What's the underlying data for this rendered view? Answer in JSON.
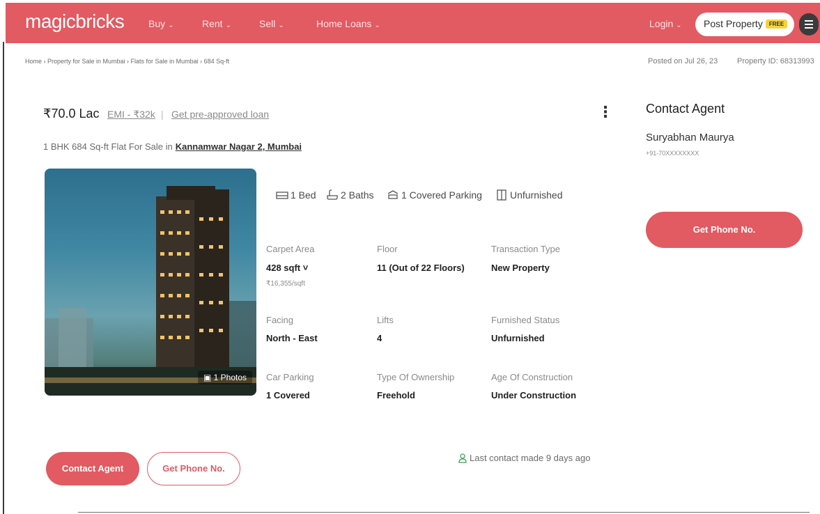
{
  "header": {
    "logo": "magicbricks",
    "nav": [
      {
        "label": "Buy"
      },
      {
        "label": "Rent"
      },
      {
        "label": "Sell"
      },
      {
        "label": "Home Loans"
      }
    ],
    "login_label": "Login",
    "post_property_label": "Post Property",
    "free_badge": "FREE",
    "brand_color": "#e25a62"
  },
  "breadcrumb": "Home › Property for Sale in Mumbai › Flats for Sale in Mumbai › 684 Sq-ft",
  "posted_on": "Posted on Jul 26, 23",
  "property_id": "Property ID: 68313993",
  "listing": {
    "price": "₹70.0 Lac",
    "emi": "EMI - ₹32k",
    "separator": "|",
    "loan_link": "Get pre-approved loan",
    "subtitle_prefix": "1 BHK 684 Sq-ft Flat For Sale in",
    "location": "Kannamwar Nagar 2, Mumbai",
    "photos_badge": "1 Photos",
    "amenities": {
      "bed": "1 Bed",
      "baths": "2 Baths",
      "parking": "1 Covered Parking",
      "furnishing": "Unfurnished"
    },
    "specs": {
      "carpet_area_label": "Carpet Area",
      "carpet_area_value": "428 sqft ˅",
      "carpet_area_sub": "₹16,355/sqft",
      "floor_label": "Floor",
      "floor_value": "11 (Out of 22 Floors)",
      "transaction_label": "Transaction Type",
      "transaction_value": "New Property",
      "facing_label": "Facing",
      "facing_value": "North - East",
      "lifts_label": "Lifts",
      "lifts_value": "4",
      "furnished_label": "Furnished Status",
      "furnished_value": "Unfurnished",
      "car_parking_label": "Car Parking",
      "car_parking_value": "1 Covered",
      "ownership_label": "Type Of Ownership",
      "ownership_value": "Freehold",
      "age_label": "Age Of Construction",
      "age_value": "Under Construction"
    },
    "contact_agent_button": "Contact Agent",
    "get_phone_button": "Get Phone No.",
    "last_contact": "Last contact made 9 days ago"
  },
  "agent_panel": {
    "title": "Contact Agent",
    "name": "Suryabhan Maurya",
    "phone": "+91-70XXXXXXXX",
    "button": "Get Phone No."
  }
}
